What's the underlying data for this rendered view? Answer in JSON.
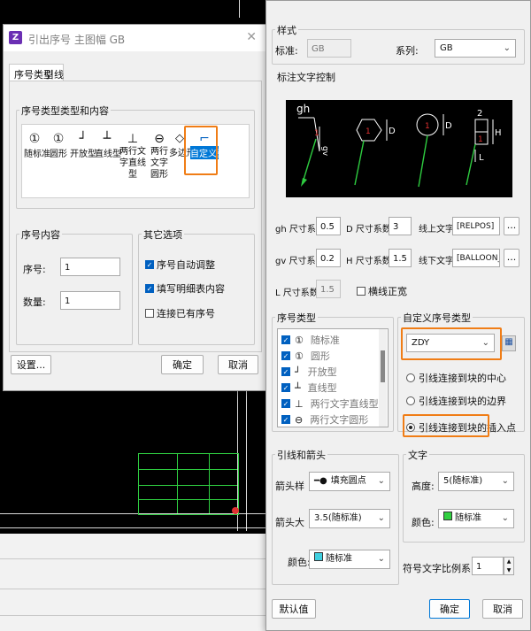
{
  "left_dialog": {
    "title": "引出序号 主图幅 GB",
    "tabs": [
      "序号类型",
      "引线"
    ],
    "type_group_label": "序号类型类型和内容",
    "types": [
      {
        "label": "随标准",
        "glyph": "①"
      },
      {
        "label": "圆形",
        "glyph": "①"
      },
      {
        "label": "开放型",
        "glyph": "┘"
      },
      {
        "label": "直线型",
        "glyph": "┴"
      },
      {
        "label": "两行文字直线型",
        "glyph": "⊥"
      },
      {
        "label": "两行文字圆形",
        "glyph": "⊖"
      },
      {
        "label": "多边形",
        "glyph": "◇"
      },
      {
        "label": "自定义型",
        "glyph": "⌐"
      }
    ],
    "content_group_label": "序号内容",
    "seq_label": "序号:",
    "seq_value": "1",
    "qty_label": "数量:",
    "qty_value": "1",
    "other_group_label": "其它选项",
    "opt_auto_adjust": "序号自动调整",
    "opt_fill_bom": "填写明细表内容",
    "opt_connect_existing": "连接已有序号",
    "settings_button": "设置...",
    "ok_button": "确定",
    "cancel_button": "取消"
  },
  "right_dialog": {
    "style_group_label": "样式",
    "standard_label": "标准:",
    "standard_value": "GB",
    "series_label": "系列:",
    "series_value": "GB",
    "text_control_label": "标注文字控制",
    "preview_labels": {
      "gh": "gh",
      "gv": "gv",
      "d": "D",
      "h": "H",
      "l": "L",
      "one": "1",
      "two": "2"
    },
    "gh_label": "gh 尺寸系数:",
    "gh_value": "0.5",
    "d_label": "D 尺寸系数:",
    "d_value": "3",
    "upper_text_label": "线上文字:",
    "upper_text_value": "[RELPOS]",
    "gv_label": "gv 尺寸系",
    "gv_value": "0.2",
    "h_label": "H 尺寸系数:",
    "h_value": "1.5",
    "lower_text_label": "线下文字:",
    "lower_text_value": "[BALLOON_PART",
    "l_label": "L 尺寸系数:",
    "l_value": "1.5",
    "opt_equal_width": "横线正宽",
    "ellipsis": "...",
    "seq_type_group_label": "序号类型",
    "seq_types": [
      "随标准",
      "圆形",
      "开放型",
      "直线型",
      "两行文字直线型",
      "两行文字圆形"
    ],
    "seq_glyphs": [
      "①",
      "①",
      "┘",
      "┴",
      "⊥",
      "⊖"
    ],
    "custom_group_label": "自定义序号类型",
    "custom_value": "ZDY",
    "radio_center": "引线连接到块的中心",
    "radio_boundary": "引线连接到块的边界",
    "radio_insert": "引线连接到块的插入点",
    "leader_group_label": "引线和箭头",
    "arrow_style_label": "箭头样",
    "arrow_style_value": "填充圆点",
    "arrow_size_label": "箭头大",
    "arrow_size_value": "3.5(随标准)",
    "color_label": "颜色:",
    "color_value": "随标准",
    "text_group_label": "文字",
    "height_label": "高度:",
    "height_value": "5(随标准)",
    "text_color_label": "颜色:",
    "text_color_value": "随标准",
    "text_scale_label": "符号文字比例系",
    "text_scale_value": "1",
    "default_button": "默认值",
    "ok_button": "确定",
    "cancel_button": "取消"
  },
  "colors": {
    "accent_orange": "#f07d16",
    "cad_green": "#2ecc40",
    "color_swatch_cyan": "#40d0e0",
    "color_swatch_green": "#30d040"
  }
}
